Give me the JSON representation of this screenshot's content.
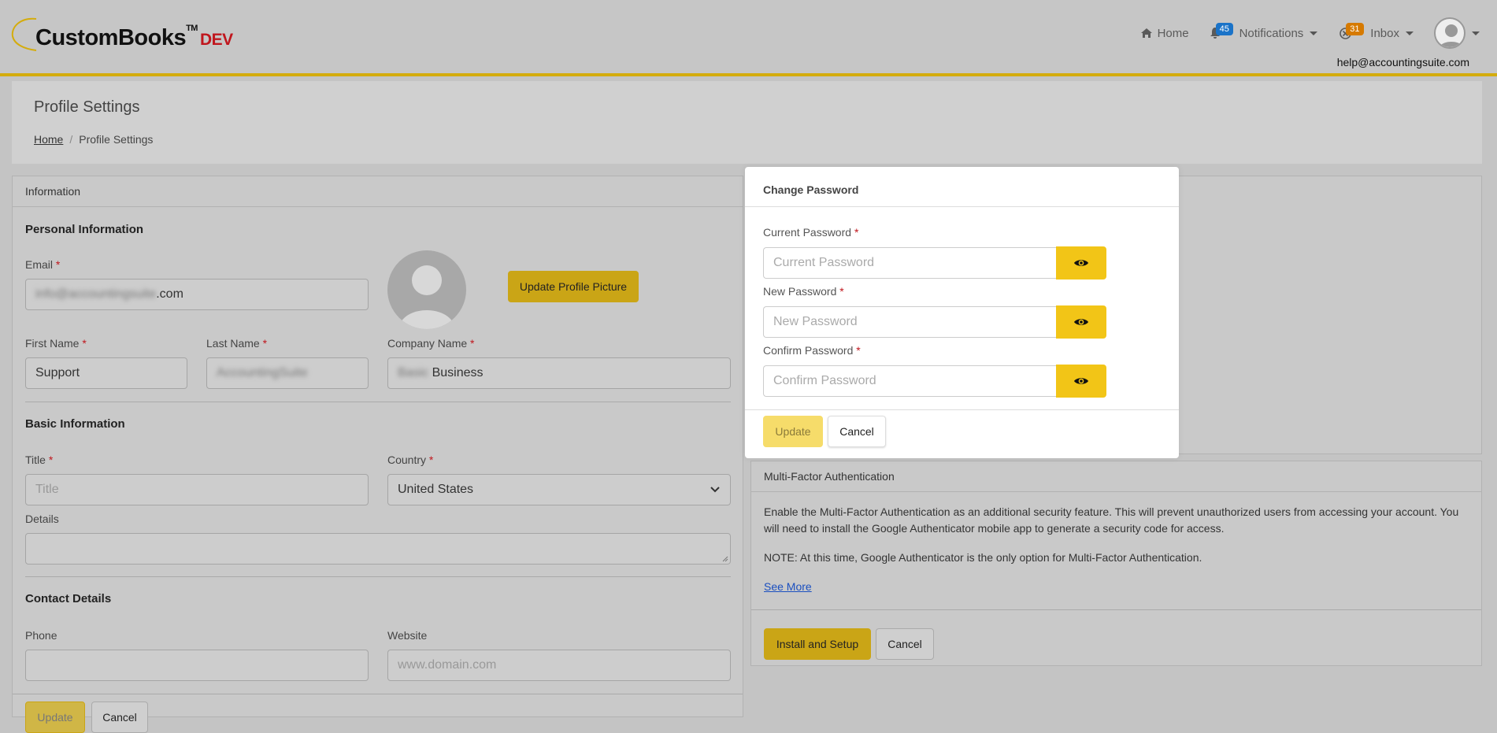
{
  "app": {
    "logo_name": "CustomBooks",
    "logo_tm": "TM",
    "logo_env": "DEV",
    "brand_color": "#d4ac0d"
  },
  "nav": {
    "home_label": "Home",
    "notifications_label": "Notifications",
    "notifications_count": "45",
    "inbox_label": "Inbox",
    "inbox_count": "31",
    "help_email": "help@accountingsuite.com"
  },
  "page": {
    "title": "Profile Settings",
    "breadcrumb": [
      "Home",
      "Profile Settings"
    ]
  },
  "info_card": {
    "header": "Information",
    "personal_title": "Personal Information",
    "email_label": "Email",
    "email_value_hidden": "info@accountingsuite",
    "email_value_visible": ".com",
    "update_picture_label": "Update Profile Picture",
    "first_name_label": "First Name",
    "first_name_value": "Support",
    "last_name_label": "Last Name",
    "last_name_value": "AccountingSuite",
    "company_name_label": "Company Name",
    "company_name_hidden": "Basic",
    "company_name_visible": "Business",
    "basic_title": "Basic Information",
    "title_label": "Title",
    "title_placeholder": "Title",
    "country_label": "Country",
    "country_value": "United States",
    "details_label": "Details",
    "contact_title": "Contact Details",
    "phone_label": "Phone",
    "website_label": "Website",
    "website_placeholder": "www.domain.com",
    "update_label": "Update",
    "cancel_label": "Cancel"
  },
  "password_modal": {
    "header": "Change Password",
    "current_label": "Current Password",
    "current_placeholder": "Current Password",
    "new_label": "New Password",
    "new_placeholder": "New Password",
    "confirm_label": "Confirm Password",
    "confirm_placeholder": "Confirm Password",
    "update_label": "Update",
    "cancel_label": "Cancel"
  },
  "mfa_card": {
    "header": "Multi-Factor Authentication",
    "description": "Enable the Multi-Factor Authentication as an additional security feature. This will prevent unauthorized users from accessing your account. You will need to install the Google Authenticator mobile app to generate a security code for access.",
    "note": "NOTE: At this time, Google Authenticator is the only option for Multi-Factor Authentication.",
    "see_more_label": "See More",
    "install_label": "Install and Setup",
    "cancel_label": "Cancel"
  }
}
